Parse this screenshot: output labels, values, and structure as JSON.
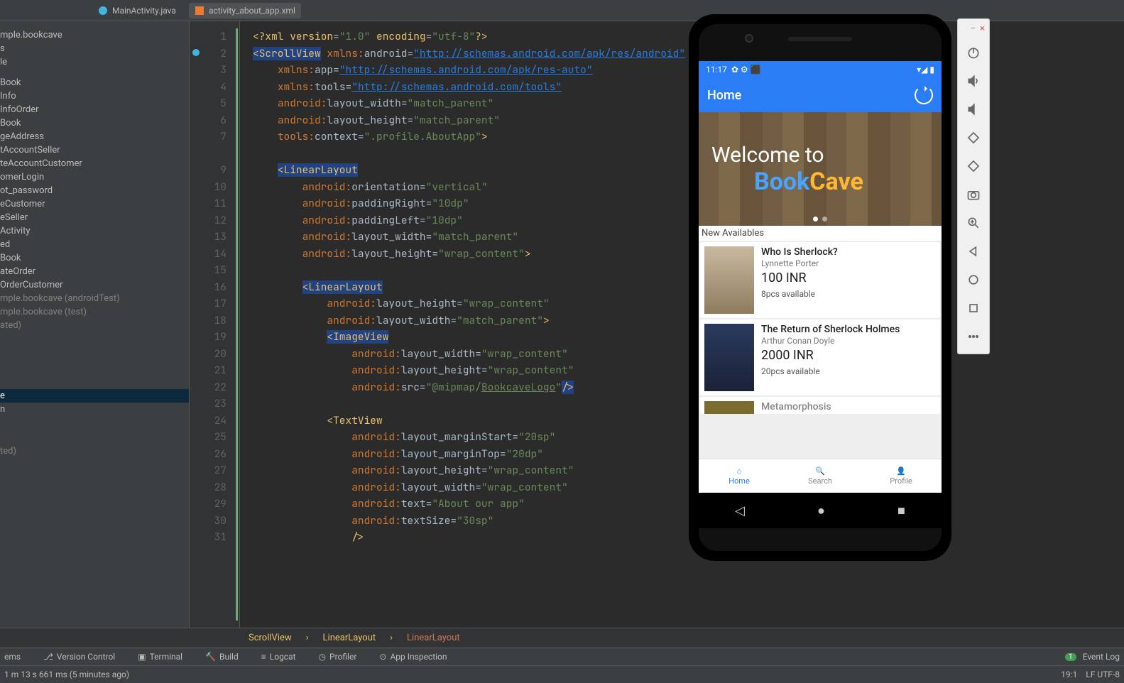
{
  "tabs": [
    {
      "label": "MainActivity.java",
      "icon_color": "#40b6e0",
      "active": false
    },
    {
      "label": "activity_about_app.xml",
      "icon_color": "#f0792b",
      "active": true
    }
  ],
  "tree": [
    "mple.bookcave",
    "s",
    "le",
    "Book",
    "Info",
    "InfoOrder",
    "Book",
    "geAddress",
    "tAccountSeller",
    "teAccountCustomer",
    "omerLogin",
    "ot_password",
    "eCustomer",
    "eSeller",
    "Activity",
    "ed",
    "Book",
    "ateOrder",
    "OrderCustomer"
  ],
  "tree_dim": [
    {
      "label": "mple.bookcave",
      "suffix": "(androidTest)"
    },
    {
      "label": "mple.bookcave",
      "suffix": "(test)"
    },
    {
      "label": "ated)",
      "suffix": ""
    }
  ],
  "tree_lower": [
    "e",
    "n",
    "ted)"
  ],
  "code": {
    "l1a": "<?",
    "l1b": "xml version",
    "l1c": "=",
    "l1d": "\"1.0\"",
    "l1e": " encoding",
    "l1f": "=",
    "l1g": "\"utf-8\"",
    "l1h": "?>",
    "l2": "<ScrollView",
    "l2ns": " xmlns:",
    "l2a": "android",
    "l2e": "=",
    "l2v": "\"http://schemas.android.com/apk/res/android\"",
    "l3a": "xmlns:",
    "l3b": "app",
    "l3e": "=",
    "l3v": "\"http://schemas.android.com/apk/res-auto\"",
    "l4a": "xmlns:",
    "l4b": "tools",
    "l4e": "=",
    "l4v": "\"http://schemas.android.com/tools\"",
    "l5a": "android:",
    "l5b": "layout_width",
    "l5e": "=",
    "l5v": "\"match_parent\"",
    "l6a": "android:",
    "l6b": "layout_height",
    "l6e": "=",
    "l6v": "\"match_parent\"",
    "l7a": "tools:",
    "l7b": "context",
    "l7e": "=",
    "l7v": "\".profile.AboutApp\"",
    "l7c": ">",
    "l9": "<LinearLayout",
    "l10a": "android:",
    "l10b": "orientation",
    "l10e": "=",
    "l10v": "\"vertical\"",
    "l11a": "android:",
    "l11b": "paddingRight",
    "l11e": "=",
    "l11v": "\"10dp\"",
    "l12a": "android:",
    "l12b": "paddingLeft",
    "l12e": "=",
    "l12v": "\"10dp\"",
    "l13a": "android:",
    "l13b": "layout_width",
    "l13e": "=",
    "l13v": "\"match_parent\"",
    "l14a": "android:",
    "l14b": "layout_height",
    "l14e": "=",
    "l14v": "\"wrap_content\"",
    "l14c": ">",
    "l16": "<LinearLayout",
    "l17a": "android:",
    "l17b": "layout_height",
    "l17e": "=",
    "l17v": "\"wrap_content\"",
    "l18a": "android:",
    "l18b": "layout_width",
    "l18e": "=",
    "l18v": "\"match_parent\"",
    "l18c": ">",
    "l19": "<ImageView",
    "l20a": "android:",
    "l20b": "layout_width",
    "l20e": "=",
    "l20v": "\"wrap_content\"",
    "l21a": "android:",
    "l21b": "layout_height",
    "l21e": "=",
    "l21v": "\"wrap_content\"",
    "l22a": "android:",
    "l22b": "src",
    "l22e": "=",
    "l22v1": "\"@mipmap/",
    "l22v2": "BookcaveLogo",
    "l22v3": "\"",
    "l22c": "/>",
    "l24": "<TextView",
    "l25a": "android:",
    "l25b": "layout_marginStart",
    "l25e": "=",
    "l25v": "\"20sp\"",
    "l26a": "android:",
    "l26b": "layout_marginTop",
    "l26e": "=",
    "l26v": "\"20dp\"",
    "l27a": "android:",
    "l27b": "layout_height",
    "l27e": "=",
    "l27v": "\"wrap_content\"",
    "l28a": "android:",
    "l28b": "layout_width",
    "l28e": "=",
    "l28v": "\"wrap_content\"",
    "l29a": "android:",
    "l29b": "text",
    "l29e": "=",
    "l29v": "\"About our app\"",
    "l30a": "android:",
    "l30b": "textSize",
    "l30e": "=",
    "l30v": "\"30sp\"",
    "l31": "/>"
  },
  "line_numbers": [
    "1",
    "2",
    "3",
    "4",
    "5",
    "6",
    "7",
    "",
    "9",
    "10",
    "11",
    "12",
    "13",
    "14",
    "15",
    "16",
    "17",
    "18",
    "19",
    "20",
    "21",
    "22",
    "23",
    "24",
    "25",
    "26",
    "27",
    "28",
    "29",
    "30",
    "31"
  ],
  "breadcrumb": [
    "ScrollView",
    "LinearLayout",
    "LinearLayout"
  ],
  "bottom_tools": [
    "ems",
    "Version Control",
    "Terminal",
    "Build",
    "Logcat",
    "Profiler",
    "App Inspection"
  ],
  "status": {
    "left": "1 m 13 s 661 ms (5 minutes ago)",
    "event_log": "Event Log",
    "pos": "19:1",
    "enc": "LF   UTF-8"
  },
  "emulator": {
    "close": "×",
    "minimize": "−"
  },
  "app": {
    "time": "11:17",
    "status_icons": "✿ ⚙ ⬛",
    "signal": "▾◢ ▮",
    "header": "Home",
    "welcome": "Welcome to",
    "logo1": "Book",
    "logo2": "Cave",
    "section": "New Availables",
    "books": [
      {
        "title": "Who Is Sherlock?",
        "author": "Lynnette Porter",
        "price": "100 INR",
        "stock": "8pcs available"
      },
      {
        "title": "The Return of Sherlock Holmes",
        "author": "Arthur Conan Doyle",
        "price": "2000 INR",
        "stock": "20pcs available"
      },
      {
        "title": "Metamorphosis",
        "author": "",
        "price": "",
        "stock": ""
      }
    ],
    "nav": [
      {
        "label": "Home",
        "active": true
      },
      {
        "label": "Search",
        "active": false
      },
      {
        "label": "Profile",
        "active": false
      }
    ]
  }
}
